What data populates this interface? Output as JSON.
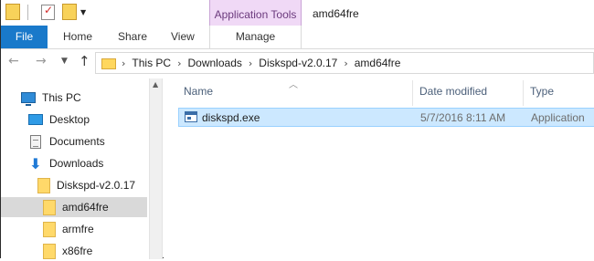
{
  "window": {
    "title": "amd64fre",
    "context_tab_group": "Application Tools"
  },
  "ribbon": {
    "tabs": [
      {
        "label": "File"
      },
      {
        "label": "Home"
      },
      {
        "label": "Share"
      },
      {
        "label": "View"
      },
      {
        "label": "Manage"
      }
    ]
  },
  "address": {
    "breadcrumbs": [
      "This PC",
      "Downloads",
      "Diskspd-v2.0.17",
      "amd64fre"
    ],
    "separator": "›"
  },
  "nav_pane": {
    "items": [
      {
        "label": "This PC",
        "icon": "computer-icon"
      },
      {
        "label": "Desktop",
        "icon": "desktop-icon"
      },
      {
        "label": "Documents",
        "icon": "documents-icon"
      },
      {
        "label": "Downloads",
        "icon": "downloads-icon"
      },
      {
        "label": "Diskspd-v2.0.17",
        "icon": "folder-icon"
      },
      {
        "label": "amd64fre",
        "icon": "folder-icon",
        "selected": true
      },
      {
        "label": "armfre",
        "icon": "folder-icon"
      },
      {
        "label": "x86fre",
        "icon": "folder-icon"
      }
    ]
  },
  "file_list": {
    "columns": [
      "Name",
      "Date modified",
      "Type"
    ],
    "rows": [
      {
        "name": "diskspd.exe",
        "date_modified": "5/7/2016 8:11 AM",
        "type": "Application",
        "selected": true
      }
    ]
  },
  "colors": {
    "file_tab": "#1979ca",
    "context_tab": "#f0d9f6",
    "selection": "#cce8ff",
    "tree_selection": "#d9d9d9"
  }
}
